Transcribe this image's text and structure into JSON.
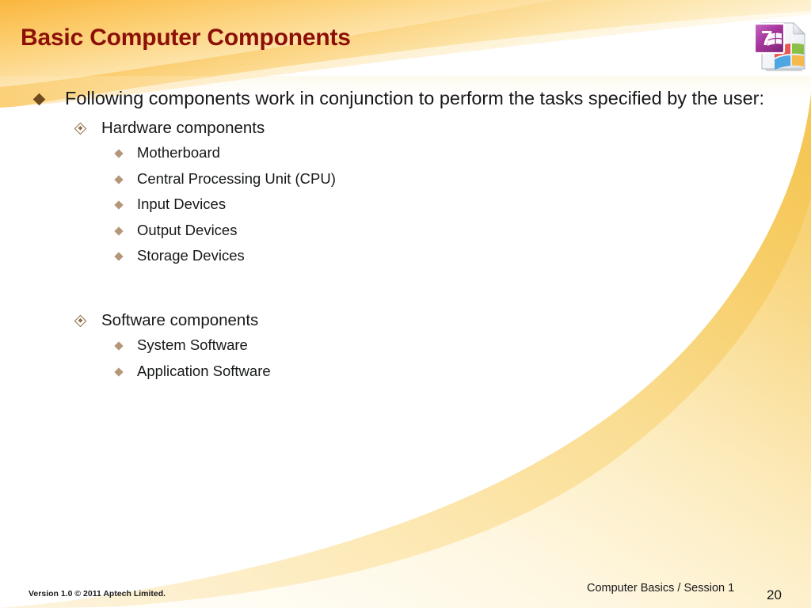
{
  "slide": {
    "title": "Basic Computer Components",
    "title_color": "#8C1007",
    "accent_orange": "#F7A221",
    "accent_gold": "#F8CE63",
    "bullet_l1_color": "#6E4A1E",
    "bullet_l2_color": "#8A6A3E",
    "bullet_l3_color": "#B49778"
  },
  "logo": {
    "name": "windows-7-document-icon",
    "badge_text": "7"
  },
  "body": {
    "intro": "Following components work in conjunction to perform the tasks specified by the user:",
    "groups": [
      {
        "label": "Hardware components",
        "items": [
          "Motherboard",
          "Central Processing Unit (CPU)",
          "Input Devices",
          "Output Devices",
          "Storage Devices"
        ]
      },
      {
        "label": "Software components",
        "items": [
          "System Software",
          "Application Software"
        ]
      }
    ]
  },
  "footer": {
    "version": "Version 1.0 © 2011 Aptech Limited.",
    "course": "Computer Basics / Session 1",
    "page_number": "20"
  }
}
